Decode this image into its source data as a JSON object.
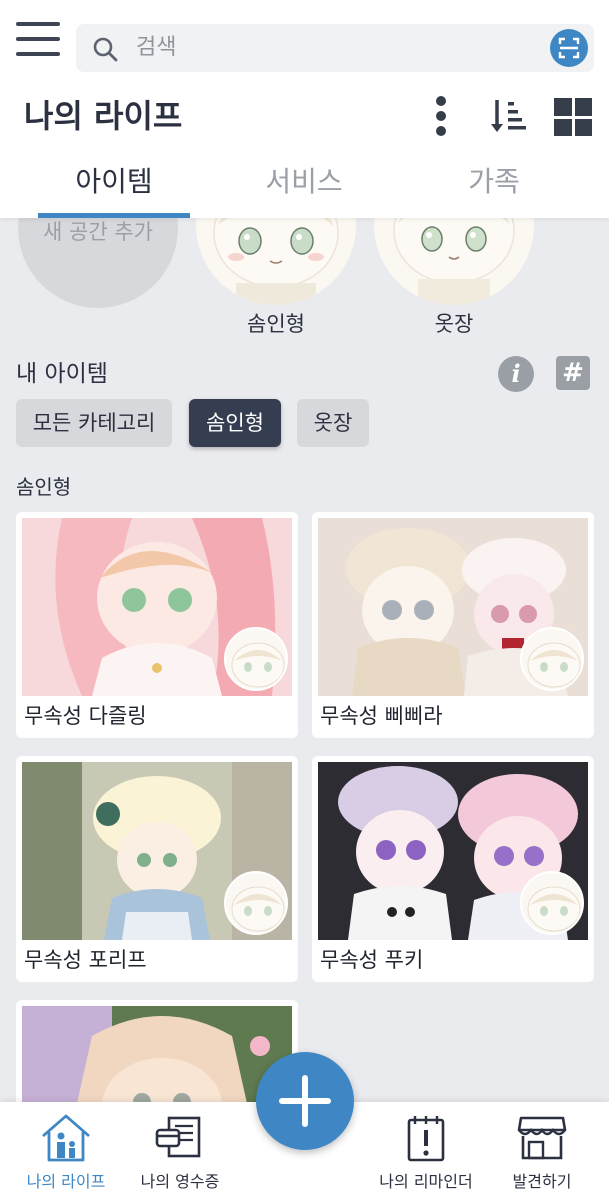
{
  "search": {
    "placeholder": "검색"
  },
  "header": {
    "title": "나의 라이프"
  },
  "tabs": [
    {
      "label": "아이템",
      "active": true
    },
    {
      "label": "서비스",
      "active": false
    },
    {
      "label": "가족",
      "active": false
    }
  ],
  "spaces": {
    "add_label": "새 공간 추가",
    "items": [
      {
        "label": "솜인형"
      },
      {
        "label": "옷장"
      }
    ]
  },
  "my_items": {
    "title": "내 아이템",
    "filters": [
      {
        "label": "모든 카테고리",
        "active": false
      },
      {
        "label": "솜인형",
        "active": true
      },
      {
        "label": "옷장",
        "active": false
      }
    ],
    "group_label": "솜인형",
    "cards": [
      {
        "name": "무속성 다즐링"
      },
      {
        "name": "무속성 삐삐라"
      },
      {
        "name": "무속성 포리프"
      },
      {
        "name": "무속성 푸키"
      },
      {
        "name": ""
      }
    ]
  },
  "bottom_nav": [
    {
      "label": "나의 라이프",
      "active": true
    },
    {
      "label": "나의 영수증",
      "active": false
    },
    {
      "label": "나의 리마인더",
      "active": false
    },
    {
      "label": "발견하기",
      "active": false
    }
  ],
  "colors": {
    "accent": "#3f87c4",
    "dark": "#353e50",
    "background": "#eaebef"
  }
}
